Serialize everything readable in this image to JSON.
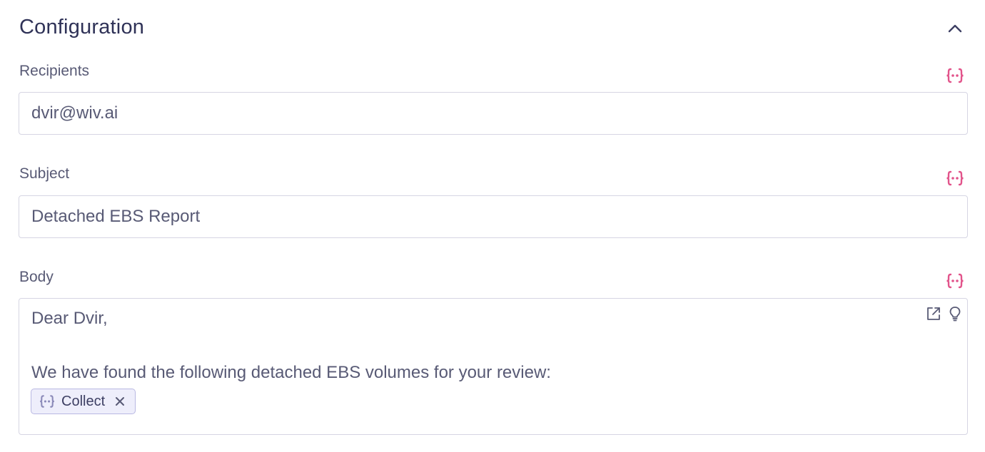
{
  "section": {
    "title": "Configuration",
    "collapse_icon": "chevron-up-icon"
  },
  "fields": {
    "recipients": {
      "label": "Recipients",
      "value": "dvir@wiv.ai",
      "variable_icon": "variable-braces-icon"
    },
    "subject": {
      "label": "Subject",
      "value": "Detached EBS Report",
      "variable_icon": "variable-braces-icon"
    },
    "body": {
      "label": "Body",
      "line1": "Dear Dvir,",
      "line2": "We have found the following detached EBS volumes for your review:",
      "chip": {
        "label": "Collect",
        "icon": "variable-braces-icon"
      },
      "tools": [
        "external-link-icon",
        "lightbulb-icon"
      ]
    }
  },
  "colors": {
    "accent_pink": "#e2548b",
    "title": "#2f3257",
    "text": "#585a75",
    "border": "#d6d5e3",
    "chip_bg": "#eeeefb",
    "chip_border": "#b9b8e2"
  }
}
